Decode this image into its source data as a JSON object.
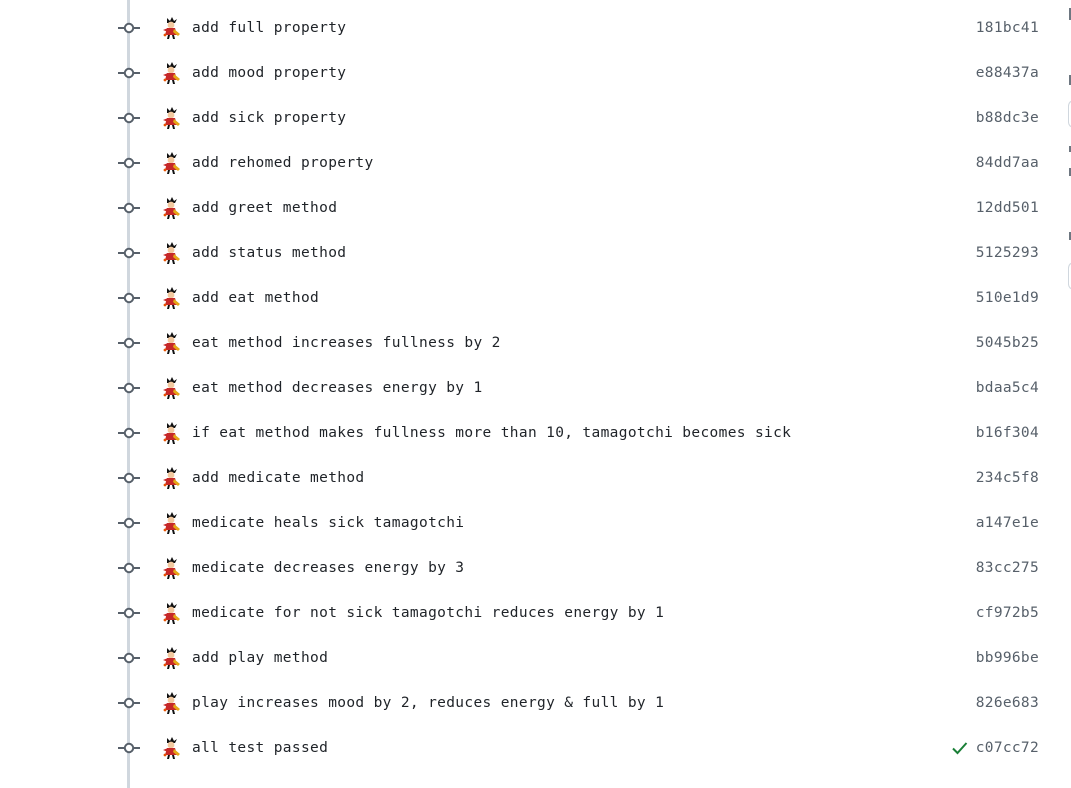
{
  "commits": [
    {
      "message": "add full property",
      "sha": "181bc41",
      "checked": false
    },
    {
      "message": "add mood property",
      "sha": "e88437a",
      "checked": false
    },
    {
      "message": "add sick property",
      "sha": "b88dc3e",
      "checked": false
    },
    {
      "message": "add rehomed property",
      "sha": "84dd7aa",
      "checked": false
    },
    {
      "message": "add greet method",
      "sha": "12dd501",
      "checked": false
    },
    {
      "message": "add status method",
      "sha": "5125293",
      "checked": false
    },
    {
      "message": "add eat method",
      "sha": "510e1d9",
      "checked": false
    },
    {
      "message": "eat method increases fullness by 2",
      "sha": "5045b25",
      "checked": false
    },
    {
      "message": "eat method decreases energy by 1",
      "sha": "bdaa5c4",
      "checked": false
    },
    {
      "message": "if eat method makes fullness more than 10, tamagotchi becomes sick",
      "sha": "b16f304",
      "checked": false
    },
    {
      "message": "add medicate method",
      "sha": "234c5f8",
      "checked": false
    },
    {
      "message": "medicate heals sick tamagotchi",
      "sha": "a147e1e",
      "checked": false
    },
    {
      "message": "medicate decreases energy by 3",
      "sha": "83cc275",
      "checked": false
    },
    {
      "message": "medicate for not sick tamagotchi reduces energy by 1",
      "sha": "cf972b5",
      "checked": false
    },
    {
      "message": "add play method",
      "sha": "bb996be",
      "checked": false
    },
    {
      "message": "play increases mood by 2, reduces energy & full by 1",
      "sha": "826e683",
      "checked": false
    },
    {
      "message": "all test passed",
      "sha": "c07cc72",
      "checked": true
    }
  ],
  "icons": {
    "commit_node": "git-commit-icon",
    "avatar": "user-avatar",
    "status": "check-icon"
  },
  "colors": {
    "timeline": "#d0d7de",
    "text": "#1f2328",
    "sha": "#57606a",
    "success": "#1a7f37"
  }
}
